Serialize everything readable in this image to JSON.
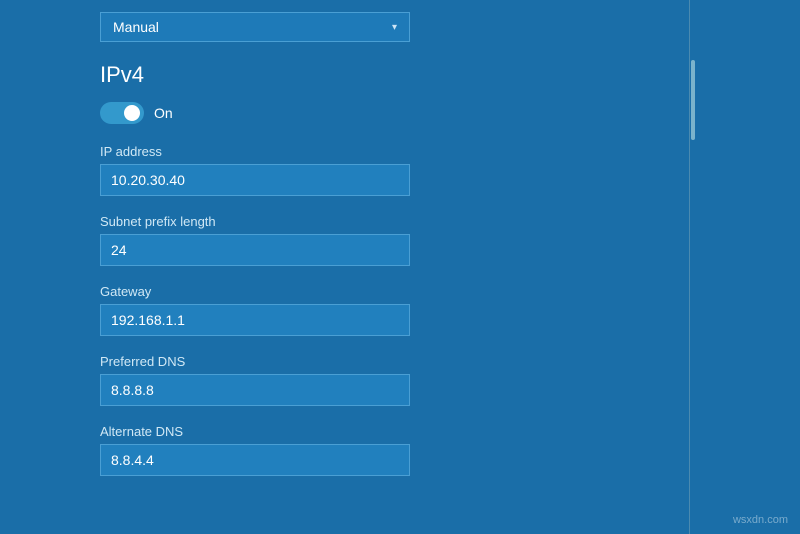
{
  "dropdown": {
    "value": "Manual",
    "arrow": "▾"
  },
  "ipv4": {
    "title": "IPv4",
    "toggle": {
      "state": "On"
    },
    "fields": [
      {
        "label": "IP address",
        "value": "10.20.30.40"
      },
      {
        "label": "Subnet prefix length",
        "value": "24"
      },
      {
        "label": "Gateway",
        "value": "192.168.1.1"
      },
      {
        "label": "Preferred DNS",
        "value": "8.8.8.8"
      },
      {
        "label": "Alternate DNS",
        "value": "8.8.4.4"
      }
    ]
  },
  "watermark": "wsxdn.com"
}
